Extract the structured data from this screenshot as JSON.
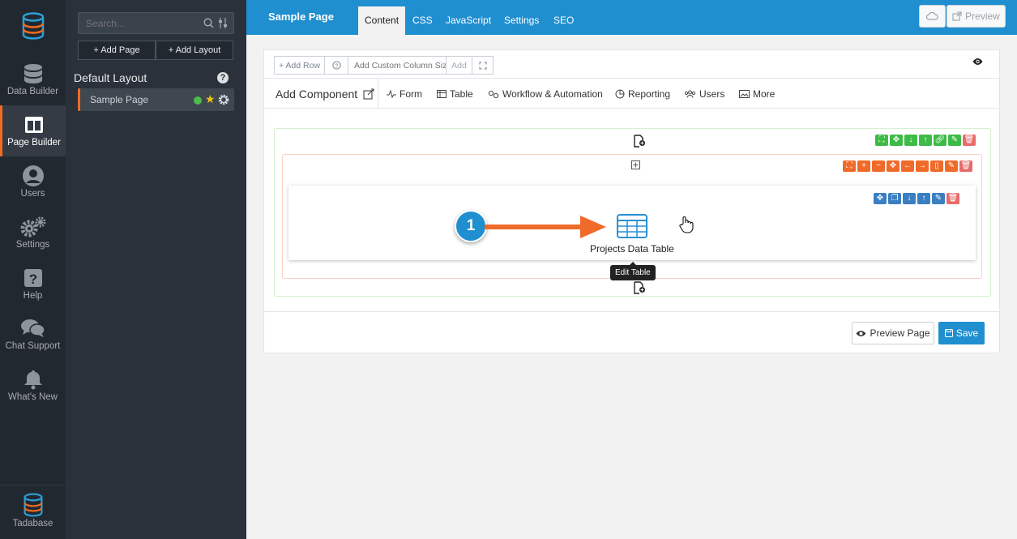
{
  "nav": {
    "items": [
      {
        "label": "Data Builder",
        "icon": "database-icon"
      },
      {
        "label": "Page Builder",
        "icon": "layout-icon"
      },
      {
        "label": "Users",
        "icon": "user-icon"
      },
      {
        "label": "Settings",
        "icon": "gears-icon"
      },
      {
        "label": "Help",
        "icon": "help-icon"
      },
      {
        "label": "Chat Support",
        "icon": "chat-icon"
      },
      {
        "label": "What's New",
        "icon": "bell-icon"
      }
    ],
    "bottom_label": "Tadabase"
  },
  "sidebar": {
    "search_placeholder": "Search...",
    "add_page": "+ Add Page",
    "add_layout": "+ Add Layout",
    "layout_title": "Default Layout",
    "page_item": "Sample Page"
  },
  "topbar": {
    "title": "Sample Page",
    "tabs": [
      "Content",
      "CSS",
      "JavaScript",
      "Settings",
      "SEO"
    ],
    "preview": "Preview"
  },
  "toolbar": {
    "add_row": "+ Add Row",
    "custom_placeholder": "Add Custom Column Size",
    "add": "Add"
  },
  "components": {
    "add_component": "Add Component",
    "items": [
      "Form",
      "Table",
      "Workflow & Automation",
      "Reporting",
      "Users",
      "More"
    ]
  },
  "table_component": {
    "label": "Projects Data Table",
    "tooltip": "Edit Table"
  },
  "footer": {
    "preview_page": "Preview Page",
    "save": "Save"
  },
  "callout": {
    "number": "1"
  },
  "colors": {
    "accent": "#1f8fd0",
    "active": "#f26b21",
    "green": "#3dbb47",
    "orange": "#f06a2a",
    "blue": "#3a7fc1",
    "red": "#e86b6b"
  }
}
